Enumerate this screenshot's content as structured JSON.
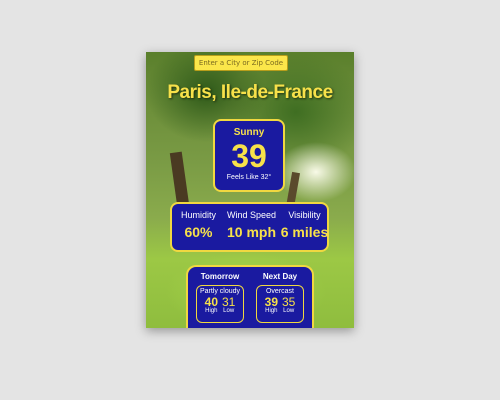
{
  "search": {
    "placeholder": "Enter a City or Zip Code"
  },
  "location": "Paris, Ile-de-France",
  "current": {
    "condition": "Sunny",
    "temperature": "39",
    "feels_like": "Feels Like 32°"
  },
  "details": [
    {
      "label": "Humidity",
      "value": "60%"
    },
    {
      "label": "Wind Speed",
      "value": "10 mph"
    },
    {
      "label": "Visibility",
      "value": "6 miles"
    }
  ],
  "forecast": [
    {
      "day": "Tomorrow",
      "condition": "Partly cloudy",
      "high": "40",
      "low": "31",
      "high_label": "High",
      "low_label": "Low"
    },
    {
      "day": "Next Day",
      "condition": "Overcast",
      "high": "39",
      "low": "35",
      "high_label": "High",
      "low_label": "Low"
    }
  ],
  "colors": {
    "card_bg": "#1a1aa0",
    "accent": "#f7e14a",
    "border": "#f0d840"
  }
}
